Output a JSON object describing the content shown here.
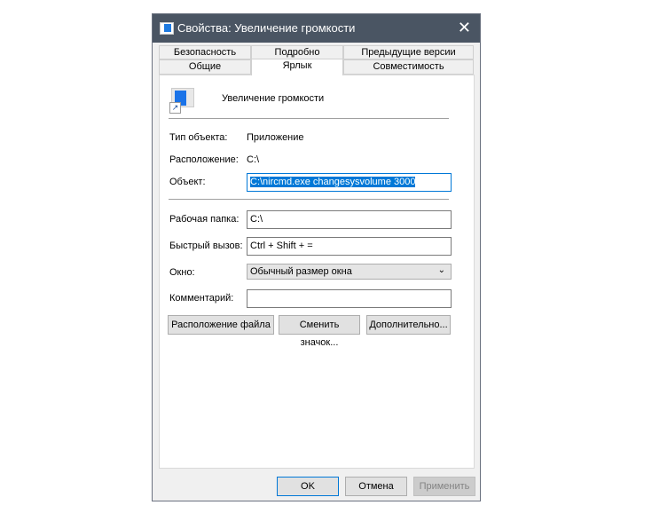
{
  "window": {
    "title": "Свойства: Увеличение громкости",
    "close": "✕"
  },
  "tabs_row1": [
    "Безопасность",
    "Подробно",
    "Предыдущие версии"
  ],
  "tabs_row2": [
    "Общие",
    "Ярлык",
    "Совместимость"
  ],
  "shortcut_name": "Увеличение громкости",
  "fields": {
    "type_label": "Тип объекта:",
    "type_value": "Приложение",
    "location_label": "Расположение:",
    "location_value": "C:\\",
    "target_label": "Объект:",
    "target_value": "C:\\nircmd.exe changesysvolume 3000",
    "workdir_label": "Рабочая папка:",
    "workdir_value": "C:\\",
    "hotkey_label": "Быстрый вызов:",
    "hotkey_value": "Ctrl + Shift + =",
    "window_label": "Окно:",
    "window_value": "Обычный размер окна",
    "comment_label": "Комментарий:",
    "comment_value": ""
  },
  "buttons": {
    "open_location": "Расположение файла",
    "change_icon": "Сменить значок...",
    "advanced": "Дополнительно...",
    "ok": "OK",
    "cancel": "Отмена",
    "apply": "Применить"
  }
}
